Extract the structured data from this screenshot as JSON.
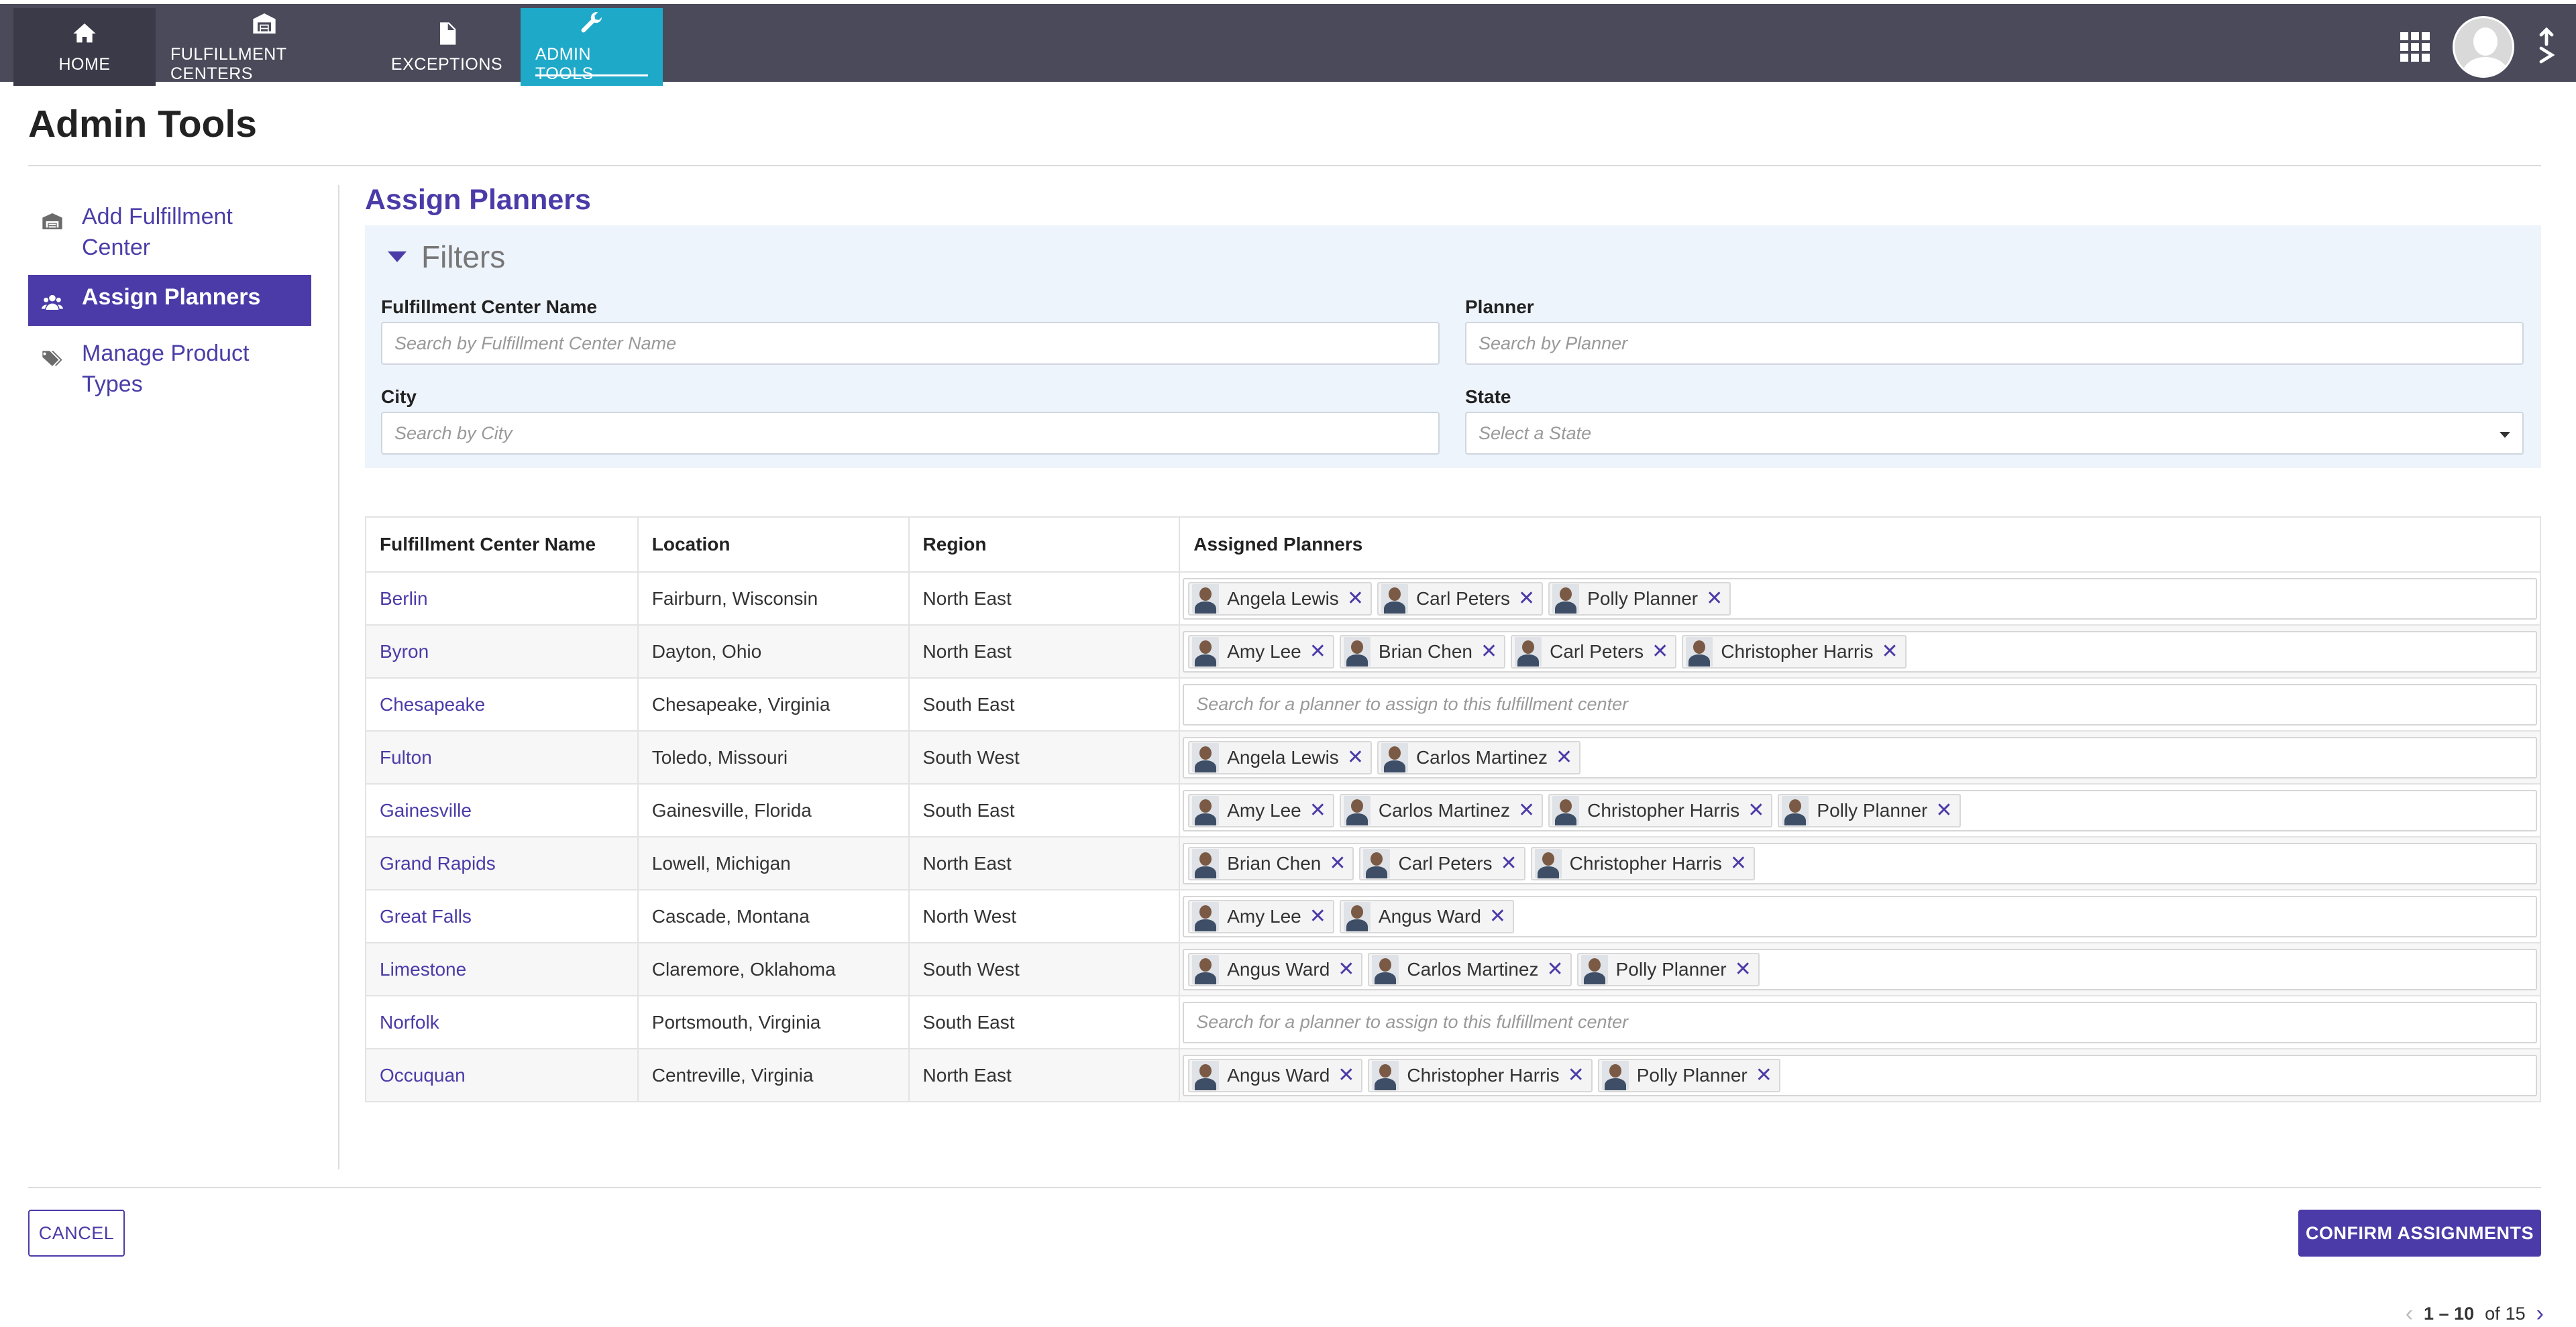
{
  "nav": {
    "items": [
      {
        "label": "HOME",
        "icon": "home-icon"
      },
      {
        "label": "FULFILLMENT CENTERS",
        "icon": "warehouse-icon"
      },
      {
        "label": "EXCEPTIONS",
        "icon": "document-icon"
      },
      {
        "label": "ADMIN TOOLS",
        "icon": "wrench-icon",
        "active": true
      }
    ]
  },
  "page": {
    "title": "Admin Tools"
  },
  "sidebar": {
    "items": [
      {
        "label": "Add Fulfillment Center",
        "icon": "warehouse-icon"
      },
      {
        "label": "Assign Planners",
        "icon": "users-icon",
        "active": true
      },
      {
        "label": "Manage Product Types",
        "icon": "tags-icon"
      }
    ]
  },
  "assign": {
    "title": "Assign Planners",
    "filters": {
      "title": "Filters",
      "fc_name_label": "Fulfillment Center Name",
      "fc_name_placeholder": "Search by Fulfillment Center Name",
      "planner_label": "Planner",
      "planner_placeholder": "Search by Planner",
      "city_label": "City",
      "city_placeholder": "Search by City",
      "state_label": "State",
      "state_placeholder": "Select a State"
    },
    "table": {
      "headers": [
        "Fulfillment Center Name",
        "Location",
        "Region",
        "Assigned Planners"
      ],
      "empty_placeholder": "Search for a planner to assign to this fulfillment center",
      "rows": [
        {
          "name": "Berlin",
          "location": "Fairburn, Wisconsin",
          "region": "North East",
          "planners": [
            "Angela Lewis",
            "Carl Peters",
            "Polly Planner"
          ]
        },
        {
          "name": "Byron",
          "location": "Dayton, Ohio",
          "region": "North East",
          "planners": [
            "Amy Lee",
            "Brian Chen",
            "Carl Peters",
            "Christopher Harris"
          ]
        },
        {
          "name": "Chesapeake",
          "location": "Chesapeake, Virginia",
          "region": "South East",
          "planners": []
        },
        {
          "name": "Fulton",
          "location": "Toledo, Missouri",
          "region": "South West",
          "planners": [
            "Angela Lewis",
            "Carlos Martinez"
          ]
        },
        {
          "name": "Gainesville",
          "location": "Gainesville, Florida",
          "region": "South East",
          "planners": [
            "Amy Lee",
            "Carlos Martinez",
            "Christopher Harris",
            "Polly Planner"
          ]
        },
        {
          "name": "Grand Rapids",
          "location": "Lowell, Michigan",
          "region": "North East",
          "planners": [
            "Brian Chen",
            "Carl Peters",
            "Christopher Harris"
          ]
        },
        {
          "name": "Great Falls",
          "location": "Cascade, Montana",
          "region": "North West",
          "planners": [
            "Amy Lee",
            "Angus Ward"
          ]
        },
        {
          "name": "Limestone",
          "location": "Claremore, Oklahoma",
          "region": "South West",
          "planners": [
            "Angus Ward",
            "Carlos Martinez",
            "Polly Planner"
          ]
        },
        {
          "name": "Norfolk",
          "location": "Portsmouth, Virginia",
          "region": "South East",
          "planners": []
        },
        {
          "name": "Occuquan",
          "location": "Centreville, Virginia",
          "region": "North East",
          "planners": [
            "Angus Ward",
            "Christopher Harris",
            "Polly Planner"
          ]
        }
      ]
    },
    "pagination": {
      "range": "1 – 10",
      "of_label": "of",
      "total": "15"
    }
  },
  "footer": {
    "cancel_label": "CANCEL",
    "confirm_label": "CONFIRM ASSIGNMENTS"
  },
  "colors": {
    "accent": "#4b3ba8",
    "nav_bg": "#4a4a5a",
    "nav_active": "#1fa9c9",
    "filters_bg": "#eef4fb"
  }
}
